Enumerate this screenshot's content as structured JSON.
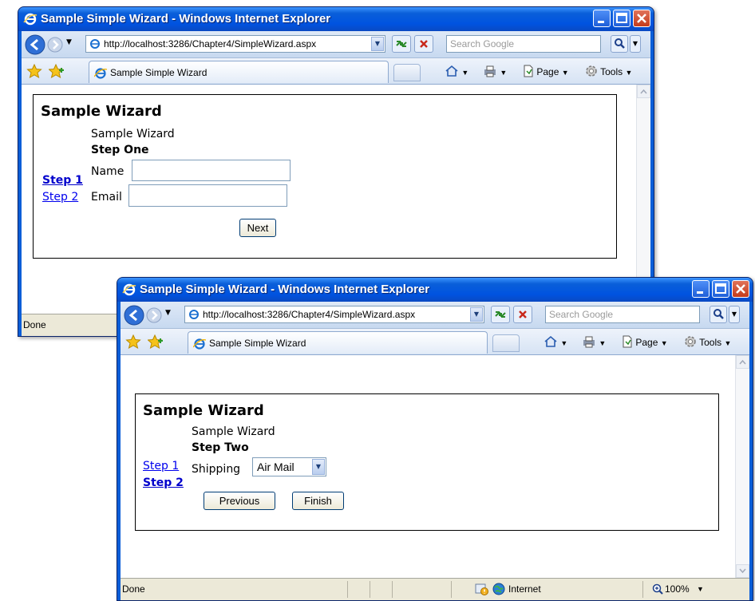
{
  "windows": [
    {
      "title": "Sample Simple Wizard - Windows Internet Explorer",
      "address": "http://localhost:3286/Chapter4/SimpleWizard.aspx",
      "search_placeholder": "Search Google",
      "tab_title": "Sample Simple Wizard",
      "commands": {
        "page": "Page",
        "tools": "Tools"
      },
      "status": "Done",
      "wizard": {
        "heading": "Sample Wizard",
        "subheading": "Sample Wizard",
        "step_title": "Step One",
        "sidebar": [
          "Step 1",
          "Step 2"
        ],
        "active_step": 0,
        "fields": [
          {
            "label": "Name",
            "value": ""
          },
          {
            "label": "Email",
            "value": ""
          }
        ],
        "buttons": {
          "next": "Next"
        }
      }
    },
    {
      "title": "Sample Simple Wizard - Windows Internet Explorer",
      "address": "http://localhost:3286/Chapter4/SimpleWizard.aspx",
      "search_placeholder": "Search Google",
      "tab_title": "Sample Simple Wizard",
      "commands": {
        "page": "Page",
        "tools": "Tools"
      },
      "status": "Done",
      "status_zone": "Internet",
      "zoom": "100%",
      "wizard": {
        "heading": "Sample Wizard",
        "subheading": "Sample Wizard",
        "step_title": "Step Two",
        "sidebar": [
          "Step 1",
          "Step 2"
        ],
        "active_step": 1,
        "shipping_label": "Shipping",
        "shipping_value": "Air Mail",
        "buttons": {
          "previous": "Previous",
          "finish": "Finish"
        }
      }
    }
  ],
  "colors": {
    "titlebar": "#0053e0",
    "link": "#0000ee",
    "statusbar": "#ece9d8"
  }
}
